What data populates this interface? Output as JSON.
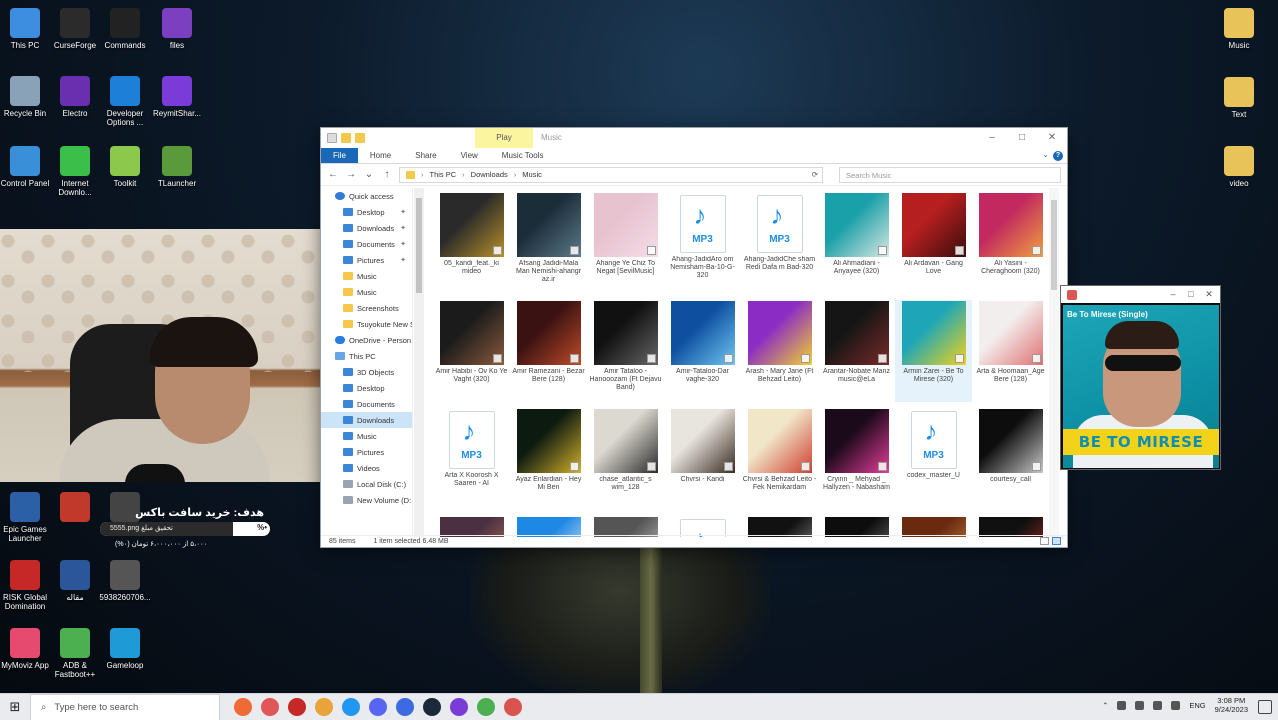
{
  "desktop": {
    "left_icons": [
      {
        "label": "This PC",
        "icon": "computer-icon",
        "color": "#3d8de0"
      },
      {
        "label": "CurseForge",
        "icon": "anvil-icon",
        "color": "#2b2b2b"
      },
      {
        "label": "Commands",
        "icon": "terminal-icon",
        "color": "#222222"
      },
      {
        "label": "files",
        "icon": "folder-icon",
        "color": "#7b3fbf"
      },
      {
        "label": "Recycle Bin",
        "icon": "recycle-bin-icon",
        "color": "#8aa2b8"
      },
      {
        "label": "Electro",
        "icon": "electro-icon",
        "color": "#6a2fae"
      },
      {
        "label": "Developer Options ...",
        "icon": "info-icon",
        "color": "#1e7fd8"
      },
      {
        "label": "ReymitShar...",
        "icon": "r-logo-icon",
        "color": "#7a3bd9"
      },
      {
        "label": "Control Panel",
        "icon": "control-panel-icon",
        "color": "#3a8fd9"
      },
      {
        "label": "Internet Downlo...",
        "icon": "download-manager-icon",
        "color": "#3bbf4a"
      },
      {
        "label": "Toolkit",
        "icon": "android-icon",
        "color": "#8cc84b"
      },
      {
        "label": "TLauncher",
        "icon": "grass-block-icon",
        "color": "#5a9a3a"
      },
      {
        "label": "Epic Games Launcher",
        "icon": "epic-games-icon",
        "color": "#2b5fa6"
      },
      {
        "label": "",
        "icon": "pdf-icon",
        "color": "#c0392b"
      },
      {
        "label": "",
        "icon": "video-file-icon",
        "color": "#444444"
      },
      {
        "label": "RISK Global Domination",
        "icon": "risk-icon",
        "color": "#c62828"
      },
      {
        "label": "مقاله",
        "icon": "word-icon",
        "color": "#2b579a"
      },
      {
        "label": "5938260706...",
        "icon": "video-file-icon",
        "color": "#555555"
      },
      {
        "label": "MyMoviz App",
        "icon": "play-circle-icon",
        "color": "#e64a6e"
      },
      {
        "label": "ADB & Fastboot++",
        "icon": "adb-icon",
        "color": "#4caf50"
      },
      {
        "label": "Gameloop",
        "icon": "gameloop-icon",
        "color": "#1e9ad6"
      }
    ],
    "right_icons": [
      {
        "label": "Music",
        "icon": "folder-icon"
      },
      {
        "label": "Text",
        "icon": "text-folder-icon"
      },
      {
        "label": "video",
        "icon": "video-folder-icon"
      }
    ]
  },
  "task_overlay": {
    "title": "هدف: خرید سافت باکس",
    "progress_label": "5555.png",
    "progress_caption": "تحقیق مبلغ",
    "percent_text": "%•",
    "progress_fraction": 0.78,
    "subtitle": "۵،۰۰۰ از ۶،۰۰۰،۰۰۰ تومان (۰%)"
  },
  "explorer": {
    "quick_access_title": "Music",
    "contextual_tab": "Play",
    "ribbon_tabs": [
      "File",
      "Home",
      "Share",
      "View",
      "Music Tools"
    ],
    "breadcrumb": [
      "This PC",
      "Downloads",
      "Music"
    ],
    "search_placeholder": "Search Music",
    "nav_items": [
      {
        "label": "Quick access",
        "icon": "star-icon",
        "pinned": false,
        "selected": false
      },
      {
        "label": "Desktop",
        "icon": "desktop-folder-icon",
        "pinned": true,
        "selected": false
      },
      {
        "label": "Downloads",
        "icon": "downloads-folder-icon",
        "pinned": true,
        "selected": false
      },
      {
        "label": "Documents",
        "icon": "documents-folder-icon",
        "pinned": true,
        "selected": false
      },
      {
        "label": "Pictures",
        "icon": "pictures-folder-icon",
        "pinned": true,
        "selected": false
      },
      {
        "label": "Music",
        "icon": "folder-icon",
        "pinned": false,
        "selected": false
      },
      {
        "label": "Music",
        "icon": "folder-icon",
        "pinned": false,
        "selected": false
      },
      {
        "label": "Screenshots",
        "icon": "folder-icon",
        "pinned": false,
        "selected": false
      },
      {
        "label": "Tsuyokute New S",
        "icon": "folder-icon",
        "pinned": false,
        "selected": false
      },
      {
        "label": "OneDrive - Person",
        "icon": "cloud-icon",
        "pinned": false,
        "selected": false
      },
      {
        "label": "This PC",
        "icon": "computer-icon",
        "pinned": false,
        "selected": false
      },
      {
        "label": "3D Objects",
        "icon": "3d-objects-icon",
        "pinned": false,
        "selected": false
      },
      {
        "label": "Desktop",
        "icon": "desktop-folder-icon",
        "pinned": false,
        "selected": false
      },
      {
        "label": "Documents",
        "icon": "documents-folder-icon",
        "pinned": false,
        "selected": false
      },
      {
        "label": "Downloads",
        "icon": "downloads-folder-icon",
        "pinned": false,
        "selected": true
      },
      {
        "label": "Music",
        "icon": "music-folder-icon",
        "pinned": false,
        "selected": false
      },
      {
        "label": "Pictures",
        "icon": "pictures-folder-icon",
        "pinned": false,
        "selected": false
      },
      {
        "label": "Videos",
        "icon": "videos-folder-icon",
        "pinned": false,
        "selected": false
      },
      {
        "label": "Local Disk (C:)",
        "icon": "drive-icon",
        "pinned": false,
        "selected": false
      },
      {
        "label": "New Volume (D:",
        "icon": "drive-icon",
        "pinned": false,
        "selected": false
      }
    ],
    "files": [
      {
        "name": "05_kandi_feat._ki mideo",
        "kind": "art",
        "c1": "#2a2a2a",
        "c2": "#b8902a"
      },
      {
        "name": "Afsang Jadidi-Mala Man Nemishi-ahangr az.ir",
        "kind": "art",
        "c1": "#1c2d3a",
        "c2": "#5c7a8a"
      },
      {
        "name": "Ahange Ye Chiz To Negat [SevilMusic]",
        "kind": "art",
        "c1": "#e7c3d0",
        "c2": "#f4dde6"
      },
      {
        "name": "Ahang-JadidAro om Nemisham-Ba-10-G-320",
        "kind": "mp3"
      },
      {
        "name": "Ahang-JadidChe sham Redi Dafa m Bad-320",
        "kind": "mp3"
      },
      {
        "name": "Ali Ahmadiani - Anyayee (320)",
        "kind": "art",
        "c1": "#1aa0a8",
        "c2": "#d9e7e3"
      },
      {
        "name": "Ali Ardavan - Gang Love",
        "kind": "art",
        "c1": "#b51f1f",
        "c2": "#3a0d0d"
      },
      {
        "name": "Ali Yasini - Cheraghoom (320)",
        "kind": "art",
        "c1": "#c2295f",
        "c2": "#f0a040"
      },
      {
        "name": "Amir Habibi - Ov Ko Ye Vaght (320)",
        "kind": "art",
        "c1": "#1b1b1b",
        "c2": "#8a5a3c"
      },
      {
        "name": "Amir Ramezani - Bezar Bere (128)",
        "kind": "art",
        "c1": "#3a1212",
        "c2": "#c04a2a"
      },
      {
        "name": "Amir Tataloo - Hanooozam (Ft Dejavu Band)",
        "kind": "art",
        "c1": "#111111",
        "c2": "#666666"
      },
      {
        "name": "Amir-Tataloo-Dar vaghe-320",
        "kind": "art",
        "c1": "#0e4fa0",
        "c2": "#6fc6f0"
      },
      {
        "name": "Arash - Mary Jane (Ft Behzad Leito)",
        "kind": "art",
        "c1": "#8b2cc4",
        "c2": "#f2d230"
      },
      {
        "name": "Arantar-Nobate Manz music@eLa",
        "kind": "art",
        "c1": "#151515",
        "c2": "#7a2a2a"
      },
      {
        "name": "Armin Zarei - Be To Mirese (320)",
        "kind": "art",
        "c1": "#1ea6b8",
        "c2": "#f3d21a",
        "selected": true
      },
      {
        "name": "Arta & Hoomaan_Age Bere (128)",
        "kind": "art",
        "c1": "#f3eeee",
        "c2": "#e07070"
      },
      {
        "name": "Arta X Koorosh X Saaren - AI",
        "kind": "mp3"
      },
      {
        "name": "Ayaz Enlardian - Hey Mi Ben",
        "kind": "art",
        "c1": "#0c1a10",
        "c2": "#d4b02a"
      },
      {
        "name": "chase_atlantic_s wim_128",
        "kind": "art",
        "c1": "#dcd9d0",
        "c2": "#2a2a2a"
      },
      {
        "name": "Chvrsi - Kandi",
        "kind": "art",
        "c1": "#e8e4de",
        "c2": "#3a2a20"
      },
      {
        "name": "Chvrsi & Behzad Leito - Fek Nemikardam",
        "kind": "art",
        "c1": "#f1e6c8",
        "c2": "#d04030"
      },
      {
        "name": "Cryinn _ Mehyad _ Hallyzen - Nabasham",
        "kind": "art",
        "c1": "#1a0a1a",
        "c2": "#e33d9a"
      },
      {
        "name": "codex_master_U",
        "kind": "mp3"
      },
      {
        "name": "courtesy_call",
        "kind": "art",
        "c1": "#0d0d0d",
        "c2": "#c7c7c7"
      },
      {
        "name": "",
        "kind": "art",
        "c1": "#4a3040",
        "c2": "#c07a60"
      },
      {
        "name": "",
        "kind": "art",
        "c1": "#1e88e5",
        "c2": "#ffffff"
      },
      {
        "name": "",
        "kind": "art",
        "c1": "#555555",
        "c2": "#dddddd"
      },
      {
        "name": "",
        "kind": "mp3"
      },
      {
        "name": "",
        "kind": "art",
        "c1": "#111111",
        "c2": "#aaaaaa"
      },
      {
        "name": "",
        "kind": "art",
        "c1": "#0d0d0d",
        "c2": "#8a8a8a"
      },
      {
        "name": "",
        "kind": "art",
        "c1": "#6a2a10",
        "c2": "#e09050"
      },
      {
        "name": "",
        "kind": "art",
        "c1": "#101010",
        "c2": "#d03030"
      }
    ],
    "status_items": "85 items",
    "status_selected": "1 item selected  6.48 MB"
  },
  "player": {
    "title": "Be To Mirese (Single)",
    "banner": "BE TO MIRESE"
  },
  "taskbar": {
    "search_placeholder": "Type here to search",
    "apps": [
      "#f06a35",
      "#e05757",
      "#c62828",
      "#e8a33a",
      "#2196f3",
      "#5865f2",
      "#3d6ae0",
      "#1b2838",
      "#7a3bd9",
      "#4caf50",
      "#d9534f"
    ],
    "lang": "ENG",
    "time": "3:08 PM",
    "date": "9/24/2023"
  }
}
